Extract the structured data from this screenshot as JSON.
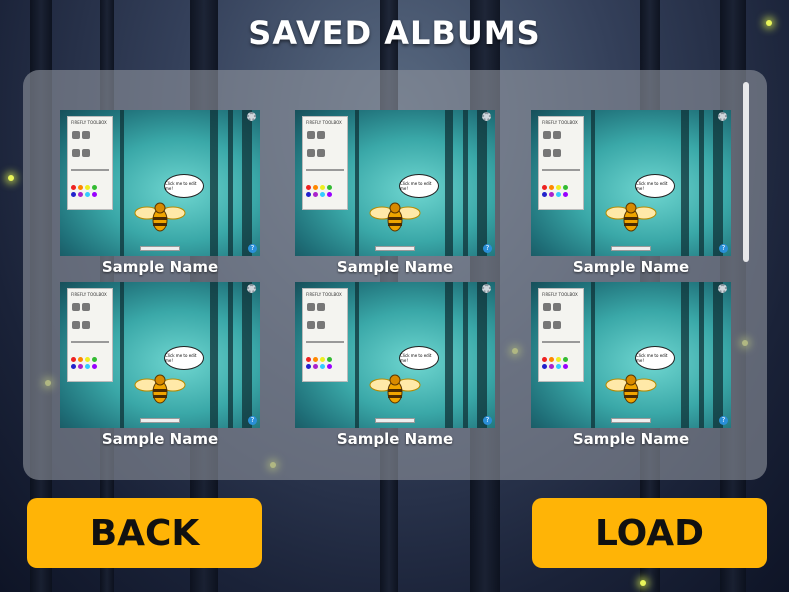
{
  "title": "SAVED ALBUMS",
  "albums": [
    {
      "name": "Sample Name",
      "toolbox_title": "FIREFLY TOOLBOX",
      "bubble_text": "Click me to edit me!"
    },
    {
      "name": "Sample Name",
      "toolbox_title": "FIREFLY TOOLBOX",
      "bubble_text": "Click me to edit me!"
    },
    {
      "name": "Sample Name",
      "toolbox_title": "FIREFLY TOOLBOX",
      "bubble_text": "Click me to edit me!"
    },
    {
      "name": "Sample Name",
      "toolbox_title": "FIREFLY TOOLBOX",
      "bubble_text": "Click me to edit me!"
    },
    {
      "name": "Sample Name",
      "toolbox_title": "FIREFLY TOOLBOX",
      "bubble_text": "Click me to edit me!"
    },
    {
      "name": "Sample Name",
      "toolbox_title": "FIREFLY TOOLBOX",
      "bubble_text": "Click me to edit me!"
    }
  ],
  "buttons": {
    "back": "BACK",
    "load": "LOAD"
  },
  "colors": {
    "button": "#ffb406",
    "panel": "rgba(140,145,155,.62)"
  },
  "icons": {
    "settings": "gear-icon",
    "help": "help-icon",
    "bee": "bee-icon"
  }
}
